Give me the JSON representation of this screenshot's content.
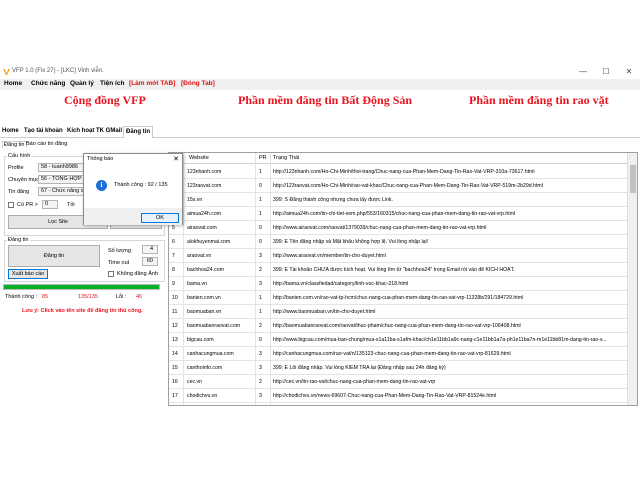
{
  "window": {
    "title": "VFP 1.0 (Fix 27) - [LKC] Vinh viễn.",
    "minimize": "—",
    "maximize": "☐",
    "close": "✕"
  },
  "menu": [
    "Home",
    "Chức năng",
    "Quản lý",
    "Tiện ích",
    "[Làm mới TAB]",
    "[Đóng Tab]"
  ],
  "banner": [
    "Cộng đồng VFP",
    "Phần mềm đăng tin Bất Động Sản",
    "Phần mềm đăng tin rao vặt"
  ],
  "main_tabs": [
    "Home",
    "Tạo tài khoản",
    "Kích hoạt TK GMail",
    "Đăng tin"
  ],
  "sub_tabs": [
    "Đăng tin",
    "Báo cáo tin đăng"
  ],
  "left": {
    "cau_hinh": "Cấu hình",
    "profile_label": "Profile",
    "profile_value": "58 - tuanh9986",
    "chuyen_muc_label": "Chuyên mục",
    "chuyen_muc_value": "56 - TỔNG HỢP",
    "tin_dang_label": "Tin đăng",
    "tin_dang_value": "67 - Chức năng cứu",
    "co_pr_label": "Có PR >",
    "co_pr_value": "0",
    "tu_label": "Tỏi",
    "loc_site": "Lọc Site",
    "cap_nhat": "Cập nhật tin",
    "dang_tin_group": "Đăng tin",
    "dang_tin_btn": "Đăng tin",
    "so_luong_label": "Số lượng",
    "so_luong_value": "4",
    "time_out_label": "Time out",
    "time_out_value": "60",
    "xuat_bao_cao": "Xuất báo cáo",
    "khong_dang_anh": "Không đăng Ảnh",
    "progress": 1.0,
    "thanh_cong_label": "Thành công :",
    "thanh_cong_value": "85",
    "count": "135/135",
    "loi_label": "Lỗi :",
    "loi_value": "46",
    "warning": "Lưu ý: Click vào tên site để đăng tin thủ công."
  },
  "grid": {
    "columns": [
      "Website",
      "PR",
      "Trạng Thái"
    ],
    "rows": [
      {
        "no": "1",
        "site": "123nhanh.com",
        "pr": "1",
        "status": "http://123nhanh.com/Ho-Chi-Minh/thoi-trang/Chuc-nang-cua-Phan-Mem-Dang-Tin-Rao-Vat-VRP-310a-73617.html"
      },
      {
        "no": "2",
        "site": "123raovat.com",
        "pr": "0",
        "status": "http://123raovat.com/Ho-Chi-Minh/rao-vat-khac/Chuc-nang-cua-Phan-Mem-Dang-Tin-Rao-Vat-VRP-519m-2b29d.html"
      },
      {
        "no": "3",
        "site": "15s.vn",
        "pr": "1",
        "status": "399: S Đăng thành công nhưng chưa lấy được Link."
      },
      {
        "no": "4",
        "site": "aimua24h.com",
        "pr": "1",
        "status": "http://aimua24h.com/tin-chi-tiet-xem.php/553/160315/chuc-nang-cua-phan-mem-dang-tin-rao-vat-vrp.html"
      },
      {
        "no": "5",
        "site": "airaovat.com",
        "pr": "0",
        "status": "http://www.airaovat.com/raovat/1379039/chuc-nang-cua-phan-mem-dang-tin-rao-vat-vrp.html"
      },
      {
        "no": "6",
        "site": "alokhuyenmai.com",
        "pr": "0",
        "status": "399: E Tên đăng nhập và Mật khẩu không hợp lệ. Vui lòng nhập lại!"
      },
      {
        "no": "7",
        "site": "araovat.vn",
        "pr": "3",
        "status": "http://www.araovat.vn/member/tin-cho-duyet.html"
      },
      {
        "no": "8",
        "site": "bachhoa24.com",
        "pr": "2",
        "status": "399: E Tài khoản CHƯA được kích hoạt. Vui lòng tìm từ \"bachhoa24\" trong Email rồi vào để KÍCH HOẠT."
      },
      {
        "no": "9",
        "site": "bama.vn",
        "pr": "3",
        "status": "http://bama.vn/classfiedad/category/linh-vuc-khac-218.html"
      },
      {
        "no": "10",
        "site": "banien.com.vn",
        "pr": "1",
        "status": "http://banien.com.vn/rao-vat-tp-hcm/chuc-nang-cua-phan-mem-dang-tin-rao-vat-vrp-11328b/291/184729.html"
      },
      {
        "no": "11",
        "site": "baomuaban.vn",
        "pr": "1",
        "status": "http://www.baomuaban.vn/tin-cho-duyet.html"
      },
      {
        "no": "12",
        "site": "baomuabanraovat.com",
        "pr": "2",
        "status": "http://baomuabanraovat.com/raovat/thuc-pham/chuc-nang-cua-phan-mem-dang-tin-rao-vat-vrp-106408.html"
      },
      {
        "no": "13",
        "site": "bigcau.com",
        "pr": "0",
        "status": "http://www.bigcau.com/mua-ban-chung/mua-s1a11ba-s1afm-khac/ch1e11bb1a9c-nang-c1e11bb1a7a-ph1e11ba7n-m1e11bb81m-dang-tin-rao-v..."
      },
      {
        "no": "14",
        "site": "canhacungmua.com",
        "pr": "3",
        "status": "http://canhacungmua.com/rao-vat/n/135123-chuc-nang-cua-phan-mem-dang-tin-rao-vat-vrp-81629.html"
      },
      {
        "no": "15",
        "site": "canthoinfo.com",
        "pr": "3",
        "status": "399: E Lỗi đăng nhập. Vui lòng KIỂM TRA lại (Đăng nhập sau 24h đăng ký)"
      },
      {
        "no": "16",
        "site": "cec.vn",
        "pr": "2",
        "status": "http://cec.vn/tin-rao-vat/chuc-nang-cua-phan-mem-dang-tin-rao-vat-vrp"
      },
      {
        "no": "17",
        "site": "chodichvu.vn",
        "pr": "3",
        "status": "http://chodichvu.vn/news-69607-Chuc-nang-cua-Phan-Mem-Dang-Tin-Rao-Vat-VRP-81524e.html"
      }
    ]
  },
  "dialog": {
    "title": "Thông báo",
    "message": "Thành công : 92 / 135",
    "ok": "OK",
    "close": "✕",
    "icon": "i"
  },
  "colors": {
    "banner_red": "#e8141f",
    "progress_green": "#06b025",
    "warning_red": "#e8141f",
    "info_blue": "#1d6fd6"
  }
}
